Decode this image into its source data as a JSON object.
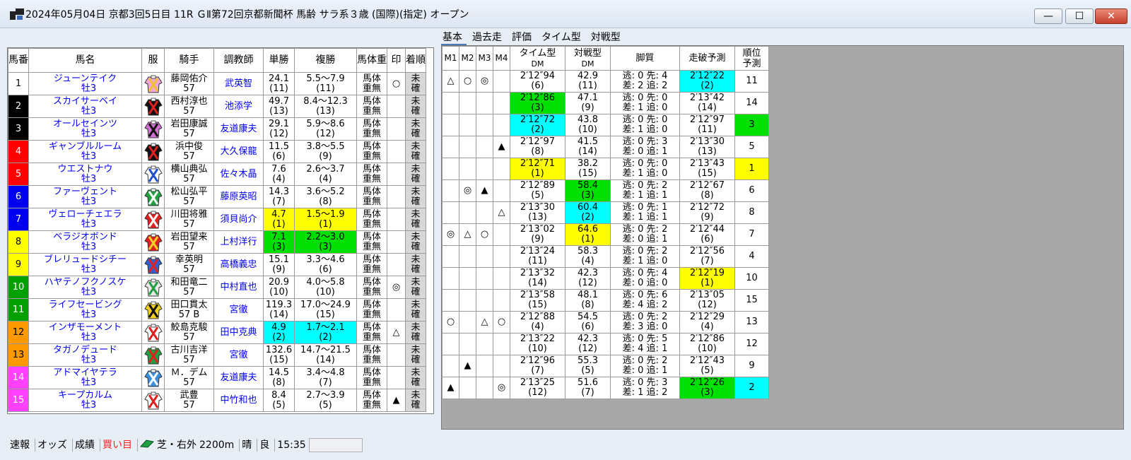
{
  "window": {
    "title": "2024年05月04日 京都3回5日目 11R ＧⅡ第72回京都新聞杯 馬齢 サラ系３歳 (国際)(指定) オープン",
    "buttons": {
      "minimize": "—",
      "maximize": "☐",
      "close": "✕"
    }
  },
  "tabs": [
    "基本",
    "過去走",
    "評価",
    "タイム型",
    "対戦型"
  ],
  "colors": {
    "yellow": "#ffff00",
    "green": "#00e000",
    "cyan": "#00ffff"
  },
  "left_table": {
    "headers": [
      "馬番",
      "馬名",
      "服",
      "騎手",
      "調教師",
      "単勝",
      "複勝",
      "馬体重",
      "印",
      "着順"
    ],
    "rows": [
      {
        "num": "1",
        "num_bg": "#ffffff",
        "num_fg": "#000000",
        "name": "ジューンテイク",
        "sex_age": "牡3",
        "silk": {
          "body": "#f0a8d8",
          "pattern": "#f0c030"
        },
        "jockey": "藤岡佑介",
        "weight": "57",
        "trainer": "武英智",
        "tan": "24.1",
        "tan_rank": "(11)",
        "fuku": "5.5～7.9",
        "fuku_rank": "(11)",
        "bw1": "馬体",
        "bw2": "重無",
        "mark": "○",
        "chaku1": "未",
        "chaku2": "確",
        "tan_bg": "",
        "fuku_bg": ""
      },
      {
        "num": "2",
        "num_bg": "#000000",
        "num_fg": "#ffffff",
        "name": "スカイサーベイ",
        "sex_age": "牡3",
        "silk": {
          "body": "#111111",
          "pattern": "#e02020"
        },
        "jockey": "西村淳也",
        "weight": "57",
        "trainer": "池添学",
        "tan": "49.7",
        "tan_rank": "(13)",
        "fuku": "8.4～12.3",
        "fuku_rank": "(13)",
        "bw1": "馬体",
        "bw2": "重無",
        "mark": "",
        "chaku1": "未",
        "chaku2": "確",
        "tan_bg": "",
        "fuku_bg": ""
      },
      {
        "num": "3",
        "num_bg": "#000000",
        "num_fg": "#ffffff",
        "name": "オールセインツ",
        "sex_age": "牡3",
        "silk": {
          "body": "#d070d0",
          "pattern": "#111111"
        },
        "jockey": "岩田康誠",
        "weight": "57",
        "trainer": "友道康夫",
        "tan": "29.1",
        "tan_rank": "(12)",
        "fuku": "5.9～8.6",
        "fuku_rank": "(12)",
        "bw1": "馬体",
        "bw2": "重無",
        "mark": "",
        "chaku1": "未",
        "chaku2": "確",
        "tan_bg": "",
        "fuku_bg": ""
      },
      {
        "num": "4",
        "num_bg": "#ff0000",
        "num_fg": "#ffffff",
        "name": "ギャンブルルーム",
        "sex_age": "牡3",
        "silk": {
          "body": "#111111",
          "pattern": "#e02020"
        },
        "jockey": "浜中俊",
        "weight": "57",
        "trainer": "大久保龍",
        "tan": "11.5",
        "tan_rank": "(6)",
        "fuku": "3.8～5.5",
        "fuku_rank": "(9)",
        "bw1": "馬体",
        "bw2": "重無",
        "mark": "",
        "chaku1": "未",
        "chaku2": "確",
        "tan_bg": "",
        "fuku_bg": ""
      },
      {
        "num": "5",
        "num_bg": "#ff0000",
        "num_fg": "#ffffff",
        "name": "ウエストナウ",
        "sex_age": "牡3",
        "silk": {
          "body": "#ffffff",
          "pattern": "#2050d0"
        },
        "jockey": "横山典弘",
        "weight": "57",
        "trainer": "佐々木晶",
        "tan": "7.6",
        "tan_rank": "(4)",
        "fuku": "2.6～3.7",
        "fuku_rank": "(4)",
        "bw1": "馬体",
        "bw2": "重無",
        "mark": "",
        "chaku1": "未",
        "chaku2": "確",
        "tan_bg": "",
        "fuku_bg": ""
      },
      {
        "num": "6",
        "num_bg": "#0000ee",
        "num_fg": "#ffffff",
        "name": "ファーヴェント",
        "sex_age": "牡3",
        "silk": {
          "body": "#20a040",
          "pattern": "#ffffff"
        },
        "jockey": "松山弘平",
        "weight": "57",
        "trainer": "藤原英昭",
        "tan": "14.3",
        "tan_rank": "(7)",
        "fuku": "3.6～5.2",
        "fuku_rank": "(8)",
        "bw1": "馬体",
        "bw2": "重無",
        "mark": "",
        "chaku1": "未",
        "chaku2": "確",
        "tan_bg": "",
        "fuku_bg": ""
      },
      {
        "num": "7",
        "num_bg": "#0000ee",
        "num_fg": "#ffffff",
        "name": "ヴェローチェエラ",
        "sex_age": "牡3",
        "silk": {
          "body": "#e02020",
          "pattern": "#ffffff"
        },
        "jockey": "川田将雅",
        "weight": "57",
        "trainer": "須貝尚介",
        "tan": "4.7",
        "tan_rank": "(1)",
        "fuku": "1.5～1.9",
        "fuku_rank": "(1)",
        "bw1": "馬体",
        "bw2": "重無",
        "mark": "",
        "chaku1": "未",
        "chaku2": "確",
        "tan_bg": "#ffff00",
        "fuku_bg": "#ffff00"
      },
      {
        "num": "8",
        "num_bg": "#ffff00",
        "num_fg": "#000000",
        "name": "ベラジオボンド",
        "sex_age": "牡3",
        "silk": {
          "body": "#e02020",
          "pattern": "#f0d020"
        },
        "jockey": "岩田望来",
        "weight": "57",
        "trainer": "上村洋行",
        "tan": "7.1",
        "tan_rank": "(3)",
        "fuku": "2.2～3.0",
        "fuku_rank": "(3)",
        "bw1": "馬体",
        "bw2": "重無",
        "mark": "",
        "chaku1": "未",
        "chaku2": "確",
        "tan_bg": "#00e000",
        "fuku_bg": "#00e000"
      },
      {
        "num": "9",
        "num_bg": "#ffff00",
        "num_fg": "#000000",
        "name": "ブレリュードシチー",
        "sex_age": "牡3",
        "silk": {
          "body": "#3060d0",
          "pattern": "#e02020"
        },
        "jockey": "幸英明",
        "weight": "57",
        "trainer": "高橋義忠",
        "tan": "15.1",
        "tan_rank": "(9)",
        "fuku": "3.3～4.6",
        "fuku_rank": "(6)",
        "bw1": "馬体",
        "bw2": "重無",
        "mark": "",
        "chaku1": "未",
        "chaku2": "確",
        "tan_bg": "",
        "fuku_bg": ""
      },
      {
        "num": "10",
        "num_bg": "#00a000",
        "num_fg": "#ffffff",
        "name": "ハヤテノフクノスケ",
        "sex_age": "牡3",
        "silk": {
          "body": "#e8e8e8",
          "pattern": "#20a040"
        },
        "jockey": "和田竜二",
        "weight": "57",
        "trainer": "中村直也",
        "tan": "20.9",
        "tan_rank": "(10)",
        "fuku": "4.0～5.8",
        "fuku_rank": "(10)",
        "bw1": "馬体",
        "bw2": "重無",
        "mark": "◎",
        "chaku1": "未",
        "chaku2": "確",
        "tan_bg": "",
        "fuku_bg": ""
      },
      {
        "num": "11",
        "num_bg": "#00a000",
        "num_fg": "#ffffff",
        "name": "ライフセービング",
        "sex_age": "牡3",
        "silk": {
          "body": "#f0d020",
          "pattern": "#111111"
        },
        "jockey": "田口貫太",
        "weight": "57 B",
        "trainer": "宮徹",
        "tan": "119.3",
        "tan_rank": "(14)",
        "fuku": "17.0～24.9",
        "fuku_rank": "(15)",
        "bw1": "馬体",
        "bw2": "重無",
        "mark": "",
        "chaku1": "未",
        "chaku2": "確",
        "tan_bg": "",
        "fuku_bg": ""
      },
      {
        "num": "12",
        "num_bg": "#ff9900",
        "num_fg": "#000000",
        "name": "インザモーメント",
        "sex_age": "牡3",
        "silk": {
          "body": "#ffffff",
          "pattern": "#e02020"
        },
        "jockey": "鮫島克駿",
        "weight": "57",
        "trainer": "田中克典",
        "tan": "4.9",
        "tan_rank": "(2)",
        "fuku": "1.7～2.1",
        "fuku_rank": "(2)",
        "bw1": "馬体",
        "bw2": "重無",
        "mark": "△",
        "chaku1": "未",
        "chaku2": "確",
        "tan_bg": "#00ffff",
        "fuku_bg": "#00ffff"
      },
      {
        "num": "13",
        "num_bg": "#ff9900",
        "num_fg": "#000000",
        "name": "タガノデュード",
        "sex_age": "牡3",
        "silk": {
          "body": "#20a040",
          "pattern": "#e02020"
        },
        "jockey": "古川吉洋",
        "weight": "57",
        "trainer": "宮徹",
        "tan": "132.6",
        "tan_rank": "(15)",
        "fuku": "14.7～21.5",
        "fuku_rank": "(14)",
        "bw1": "馬体",
        "bw2": "重無",
        "mark": "",
        "chaku1": "未",
        "chaku2": "確",
        "tan_bg": "",
        "fuku_bg": ""
      },
      {
        "num": "14",
        "num_bg": "#ff40ff",
        "num_fg": "#ffffff",
        "name": "アドマイヤテラ",
        "sex_age": "牡3",
        "silk": {
          "body": "#3a90e0",
          "pattern": "#ffffff"
        },
        "jockey": "Ｍ．デム",
        "weight": "57",
        "trainer": "友道康夫",
        "tan": "14.5",
        "tan_rank": "(8)",
        "fuku": "3.4～4.8",
        "fuku_rank": "(7)",
        "bw1": "馬体",
        "bw2": "重無",
        "mark": "",
        "chaku1": "未",
        "chaku2": "確",
        "tan_bg": "",
        "fuku_bg": ""
      },
      {
        "num": "15",
        "num_bg": "#ff40ff",
        "num_fg": "#ffffff",
        "name": "キープカルム",
        "sex_age": "牡3",
        "silk": {
          "body": "#ffffff",
          "pattern": "#e02020"
        },
        "jockey": "武豊",
        "weight": "57",
        "trainer": "中竹和也",
        "tan": "8.4",
        "tan_rank": "(5)",
        "fuku": "2.7～3.9",
        "fuku_rank": "(5)",
        "bw1": "馬体",
        "bw2": "重無",
        "mark": "▲",
        "chaku1": "未",
        "chaku2": "確",
        "tan_bg": "",
        "fuku_bg": ""
      }
    ]
  },
  "right_table": {
    "headers": {
      "m1": "M1",
      "m2": "M2",
      "m3": "M3",
      "m4": "M4",
      "time1": "タイム型",
      "time2": "DM",
      "match1": "対戦型",
      "match2": "DM",
      "kyaku": "脚質",
      "yosoku": "走破予測",
      "rank1": "順位",
      "rank2": "予測"
    },
    "rows": [
      {
        "m1": "△",
        "m2": "○",
        "m3": "◎",
        "m4": "",
        "time": "2′12″94",
        "time_rank": "(6)",
        "time_bg": "",
        "match": "42.9",
        "match_rank": "(11)",
        "match_bg": "",
        "kyaku1": "逃: 0 先: 4",
        "kyaku2": "差: 2 追: 2",
        "pred": "2′12″22",
        "pred_rank": "(2)",
        "pred_bg": "#00ffff",
        "rank": "11",
        "rank_bg": ""
      },
      {
        "m1": "",
        "m2": "",
        "m3": "",
        "m4": "",
        "time": "2′12″86",
        "time_rank": "(3)",
        "time_bg": "#00e000",
        "match": "47.1",
        "match_rank": "(9)",
        "match_bg": "",
        "kyaku1": "逃: 0 先: 0",
        "kyaku2": "差: 1 追: 0",
        "pred": "2′13″42",
        "pred_rank": "(14)",
        "pred_bg": "",
        "rank": "14",
        "rank_bg": ""
      },
      {
        "m1": "",
        "m2": "",
        "m3": "",
        "m4": "",
        "time": "2′12″72",
        "time_rank": "(2)",
        "time_bg": "#00ffff",
        "match": "43.8",
        "match_rank": "(10)",
        "match_bg": "",
        "kyaku1": "逃: 0 先: 0",
        "kyaku2": "差: 1 追: 0",
        "pred": "2′12″97",
        "pred_rank": "(11)",
        "pred_bg": "",
        "rank": "3",
        "rank_bg": "#00e000"
      },
      {
        "m1": "",
        "m2": "",
        "m3": "",
        "m4": "▲",
        "time": "2′12″97",
        "time_rank": "(8)",
        "time_bg": "",
        "match": "41.5",
        "match_rank": "(14)",
        "match_bg": "",
        "kyaku1": "逃: 0 先: 3",
        "kyaku2": "差: 0 追: 1",
        "pred": "2′13″30",
        "pred_rank": "(13)",
        "pred_bg": "",
        "rank": "5",
        "rank_bg": ""
      },
      {
        "m1": "",
        "m2": "",
        "m3": "",
        "m4": "",
        "time": "2′12″71",
        "time_rank": "(1)",
        "time_bg": "#ffff00",
        "match": "38.2",
        "match_rank": "(15)",
        "match_bg": "",
        "kyaku1": "逃: 0 先: 0",
        "kyaku2": "差: 1 追: 0",
        "pred": "2′13″43",
        "pred_rank": "(15)",
        "pred_bg": "",
        "rank": "1",
        "rank_bg": "#ffff00"
      },
      {
        "m1": "",
        "m2": "◎",
        "m3": "▲",
        "m4": "",
        "time": "2′12″89",
        "time_rank": "(5)",
        "time_bg": "",
        "match": "58.4",
        "match_rank": "(3)",
        "match_bg": "#00e000",
        "kyaku1": "逃: 0 先: 2",
        "kyaku2": "差: 1 追: 1",
        "pred": "2′12″67",
        "pred_rank": "(8)",
        "pred_bg": "",
        "rank": "6",
        "rank_bg": ""
      },
      {
        "m1": "",
        "m2": "",
        "m3": "",
        "m4": "△",
        "time": "2′13″30",
        "time_rank": "(13)",
        "time_bg": "",
        "match": "60.4",
        "match_rank": "(2)",
        "match_bg": "#00ffff",
        "kyaku1": "逃: 0 先: 1",
        "kyaku2": "差: 1 追: 1",
        "pred": "2′12″72",
        "pred_rank": "(9)",
        "pred_bg": "",
        "rank": "8",
        "rank_bg": ""
      },
      {
        "m1": "◎",
        "m2": "△",
        "m3": "○",
        "m4": "",
        "time": "2′13″02",
        "time_rank": "(9)",
        "time_bg": "",
        "match": "64.6",
        "match_rank": "(1)",
        "match_bg": "#ffff00",
        "kyaku1": "逃: 0 先: 2",
        "kyaku2": "差: 0 追: 1",
        "pred": "2′12″44",
        "pred_rank": "(6)",
        "pred_bg": "",
        "rank": "7",
        "rank_bg": ""
      },
      {
        "m1": "",
        "m2": "",
        "m3": "",
        "m4": "",
        "time": "2′13″24",
        "time_rank": "(11)",
        "time_bg": "",
        "match": "58.3",
        "match_rank": "(4)",
        "match_bg": "",
        "kyaku1": "逃: 0 先: 2",
        "kyaku2": "差: 1 追: 0",
        "pred": "2′12″56",
        "pred_rank": "(7)",
        "pred_bg": "",
        "rank": "4",
        "rank_bg": ""
      },
      {
        "m1": "",
        "m2": "",
        "m3": "",
        "m4": "",
        "time": "2′13″32",
        "time_rank": "(14)",
        "time_bg": "",
        "match": "42.3",
        "match_rank": "(12)",
        "match_bg": "",
        "kyaku1": "逃: 0 先: 4",
        "kyaku2": "差: 0 追: 0",
        "pred": "2′12″19",
        "pred_rank": "(1)",
        "pred_bg": "#ffff00",
        "rank": "10",
        "rank_bg": ""
      },
      {
        "m1": "",
        "m2": "",
        "m3": "",
        "m4": "",
        "time": "2′13″58",
        "time_rank": "(15)",
        "time_bg": "",
        "match": "48.1",
        "match_rank": "(8)",
        "match_bg": "",
        "kyaku1": "逃: 0 先: 6",
        "kyaku2": "差: 4 追: 2",
        "pred": "2′13″05",
        "pred_rank": "(12)",
        "pred_bg": "",
        "rank": "15",
        "rank_bg": ""
      },
      {
        "m1": "○",
        "m2": "",
        "m3": "△",
        "m4": "○",
        "time": "2′12″88",
        "time_rank": "(4)",
        "time_bg": "",
        "match": "54.5",
        "match_rank": "(6)",
        "match_bg": "",
        "kyaku1": "逃: 0 先: 2",
        "kyaku2": "差: 3 追: 0",
        "pred": "2′12″29",
        "pred_rank": "(4)",
        "pred_bg": "",
        "rank": "13",
        "rank_bg": ""
      },
      {
        "m1": "",
        "m2": "",
        "m3": "",
        "m4": "",
        "time": "2′13″22",
        "time_rank": "(10)",
        "time_bg": "",
        "match": "42.3",
        "match_rank": "(12)",
        "match_bg": "",
        "kyaku1": "逃: 0 先: 5",
        "kyaku2": "差: 4 追: 1",
        "pred": "2′12″86",
        "pred_rank": "(10)",
        "pred_bg": "",
        "rank": "12",
        "rank_bg": ""
      },
      {
        "m1": "",
        "m2": "▲",
        "m3": "",
        "m4": "",
        "time": "2′12″96",
        "time_rank": "(7)",
        "time_bg": "",
        "match": "55.3",
        "match_rank": "(5)",
        "match_bg": "",
        "kyaku1": "逃: 0 先: 2",
        "kyaku2": "差: 0 追: 1",
        "pred": "2′12″43",
        "pred_rank": "(5)",
        "pred_bg": "",
        "rank": "9",
        "rank_bg": ""
      },
      {
        "m1": "▲",
        "m2": "",
        "m3": "",
        "m4": "◎",
        "time": "2′13″25",
        "time_rank": "(12)",
        "time_bg": "",
        "match": "51.6",
        "match_rank": "(7)",
        "match_bg": "",
        "kyaku1": "逃: 0 先: 3",
        "kyaku2": "差: 1 追: 2",
        "pred": "2′12″26",
        "pred_rank": "(3)",
        "pred_bg": "#00e000",
        "rank": "2",
        "rank_bg": "#00ffff"
      }
    ]
  },
  "statusbar": {
    "items": [
      "速報",
      "オッズ",
      "成績",
      "買い目",
      "芝・右外",
      "2200m",
      "晴",
      "良",
      "15:35"
    ],
    "highlight_color": "#ff2020"
  }
}
